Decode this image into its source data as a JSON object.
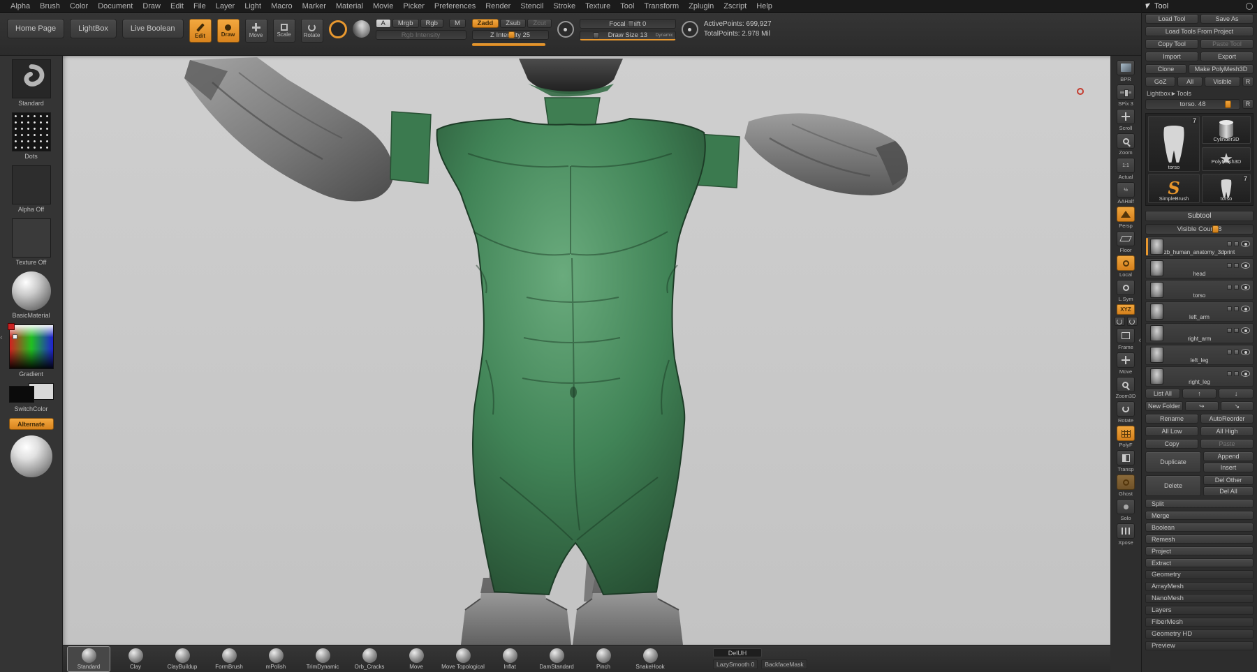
{
  "colors": {
    "accent": "#e8982f",
    "canvas_bg": "#c6c6c6",
    "model_green": "#3d8055"
  },
  "menubar": {
    "items": [
      "Alpha",
      "Brush",
      "Color",
      "Document",
      "Draw",
      "Edit",
      "File",
      "Layer",
      "Light",
      "Macro",
      "Marker",
      "Material",
      "Movie",
      "Picker",
      "Preferences",
      "Render",
      "Stencil",
      "Stroke",
      "Texture",
      "Tool",
      "Transform",
      "Zplugin",
      "Zscript",
      "Help"
    ]
  },
  "topbar": {
    "home_page": "Home Page",
    "lightbox": "LightBox",
    "live_boolean": "Live Boolean",
    "edit": "Edit",
    "draw": "Draw",
    "move": "Move",
    "scale": "Scale",
    "rotate": "Rotate",
    "paint_a": "A",
    "mrgb": "Mrgb",
    "rgb": "Rgb",
    "m": "M",
    "rgb_intensity": "Rgb Intensity",
    "zadd": "Zadd",
    "zsub": "Zsub",
    "zcut": "Zcut",
    "z_intensity": "Z Intensity 25",
    "focal_shift": "Focal Shift 0",
    "draw_size": "Draw Size 13",
    "dynamic": "Dynamic",
    "active_points": "ActivePoints: 699,927",
    "total_points": "TotalPoints: 2.978 Mil"
  },
  "left_panel": {
    "brush": "Standard",
    "stroke": "Dots",
    "alpha": "Alpha Off",
    "texture": "Texture Off",
    "material": "BasicMaterial",
    "gradient": "Gradient",
    "switch_color": "SwitchColor",
    "alternate": "Alternate"
  },
  "right_shelf": {
    "labels": [
      "BPR",
      "SPix 3",
      "Scroll",
      "Zoom",
      "Actual",
      "AAHalf",
      "Persp",
      "Floor",
      "Local",
      "L.Sym",
      "XYZ",
      "Frame",
      "Move",
      "Zoom3D",
      "Rotate",
      "PolyF",
      "Transp",
      "Ghost",
      "Solo",
      "Xpose"
    ]
  },
  "tool_panel": {
    "title": "Tool",
    "load_tool": "Load Tool",
    "save_as": "Save As",
    "load_from_project": "Load Tools From Project",
    "copy_tool": "Copy Tool",
    "paste_tool": "Paste Tool",
    "import_btn": "Import",
    "export_btn": "Export",
    "clone": "Clone",
    "make_polymesh": "Make PolyMesh3D",
    "goz": "GoZ",
    "all": "All",
    "visible": "Visible",
    "r": "R",
    "lightbox_tools": "Lightbox►Tools",
    "active_tool": "torso. 48",
    "badge": "7",
    "thumbs": {
      "current": "torso",
      "cylinder": "Cylinder3D",
      "polymesh": "PolyMesh3D",
      "simplebrush": "SimpleBrush",
      "torso_small": "torso"
    },
    "subtool": {
      "title": "Subtool",
      "visible_count": "Visible Count 8",
      "items": [
        {
          "name": "zb_human_anatomy_3dprint"
        },
        {
          "name": "head"
        },
        {
          "name": "torso"
        },
        {
          "name": "left_arm"
        },
        {
          "name": "right_arm"
        },
        {
          "name": "left_leg"
        },
        {
          "name": "right_leg"
        }
      ],
      "list_all": "List All",
      "new_folder": "New Folder",
      "rename": "Rename",
      "autoreorder": "AutoReorder",
      "all_low": "All Low",
      "all_high": "All High",
      "copy": "Copy",
      "paste": "Paste",
      "duplicate": "Duplicate",
      "append": "Append",
      "insert": "Insert",
      "delete": "Delete",
      "del_other": "Del Other",
      "del_all": "Del All",
      "split": "Split",
      "merge": "Merge",
      "boolean": "Boolean",
      "remesh": "Remesh",
      "project": "Project",
      "extract": "Extract"
    },
    "sections": [
      "Geometry",
      "ArrayMesh",
      "NanoMesh",
      "Layers",
      "FiberMesh",
      "Geometry HD",
      "Preview"
    ]
  },
  "brush_tray": {
    "brushes": [
      "Standard",
      "Clay",
      "ClayBuildup",
      "FormBrush",
      "mPolish",
      "TrimDynamic",
      "Orb_Cracks",
      "Move",
      "Move Topological",
      "Inflat",
      "DamStandard",
      "Pinch",
      "SnakeHook"
    ],
    "deluh": "DelUH",
    "lazysmooth": "LazySmooth 0",
    "backface": "BackfaceMask"
  }
}
